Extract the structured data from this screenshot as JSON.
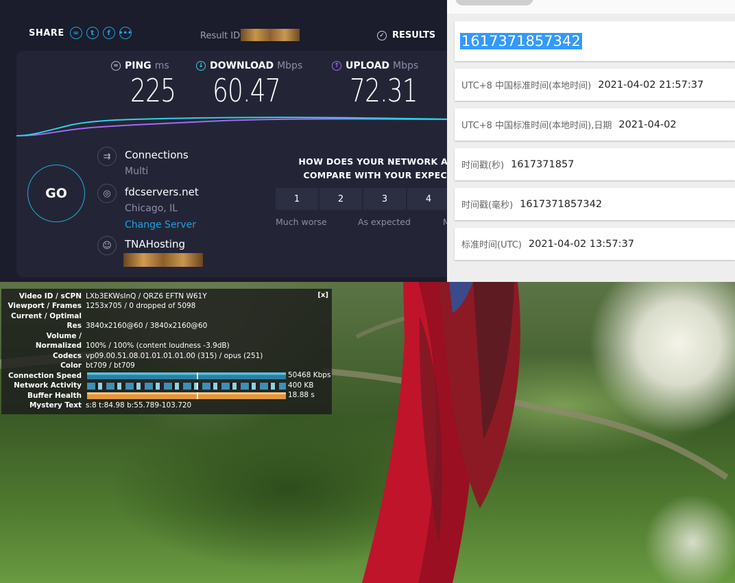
{
  "speedtest": {
    "share_label": "SHARE",
    "result_id_label": "Result ID",
    "results_label": "RESULTS",
    "go_label": "GO",
    "metrics": {
      "ping": {
        "label": "PING",
        "unit": "ms",
        "value": "225"
      },
      "download": {
        "label": "DOWNLOAD",
        "unit": "Mbps",
        "value": "60.47"
      },
      "upload": {
        "label": "UPLOAD",
        "unit": "Mbps",
        "value": "72.31"
      }
    },
    "connections": {
      "title": "Connections",
      "value": "Multi"
    },
    "server": {
      "name": "fdcservers.net",
      "location": "Chicago, IL",
      "change": "Change Server"
    },
    "isp": {
      "name": "TNAHosting"
    },
    "survey": {
      "question_line1": "HOW DOES YOUR NETWORK AVAIL",
      "question_line2": "COMPARE WITH YOUR EXPECTAT",
      "ratings": [
        "1",
        "2",
        "3",
        "4"
      ],
      "label_left": "Much worse",
      "label_mid": "As expected",
      "label_right": "M"
    },
    "colors": {
      "accent": "#1aa5e0",
      "download": "#2bd4e6",
      "upload": "#a56af2"
    }
  },
  "timestamp": {
    "main_value": "1617371857342",
    "rows": [
      {
        "label": "UTC+8 中国标准时间(本地时间)",
        "value": "2021-04-02 21:57:37"
      },
      {
        "label": "UTC+8 中国标准时间(本地时间),日期",
        "value": "2021-04-02"
      },
      {
        "label": "时间戳(秒)",
        "value": "1617371857"
      },
      {
        "label": "时间戳(毫秒)",
        "value": "1617371857342"
      },
      {
        "label": "标准时间(UTC)",
        "value": "2021-04-02 13:57:37"
      }
    ]
  },
  "stats": {
    "close": "[x]",
    "rows": [
      {
        "k": "Video ID / sCPN",
        "v": "LXb3EKWsInQ / QRZ6 EFTN W61Y"
      },
      {
        "k": "Viewport / Frames",
        "v": "1253x705 / 0 dropped of 5098"
      },
      {
        "k": "Current / Optimal",
        "v": ""
      },
      {
        "k": "Res",
        "v": "3840x2160@60 / 3840x2160@60"
      },
      {
        "k": "Volume /",
        "v": ""
      },
      {
        "k": "Normalized",
        "v": "100% / 100% (content loudness -3.9dB)"
      },
      {
        "k": "Codecs",
        "v": "vp09.00.51.08.01.01.01.01.00 (315) / opus (251)"
      },
      {
        "k": "Color",
        "v": "bt709 / bt709"
      },
      {
        "k": "Connection Speed",
        "v": ""
      },
      {
        "k": "Network Activity",
        "v": ""
      },
      {
        "k": "Buffer Health",
        "v": ""
      },
      {
        "k": "Mystery Text",
        "v": "s:8 t:84.98 b:55.789-103.720"
      }
    ],
    "connection_speed": "50468 Kbps",
    "network_activity": "400 KB",
    "buffer_health": "18.88 s"
  }
}
